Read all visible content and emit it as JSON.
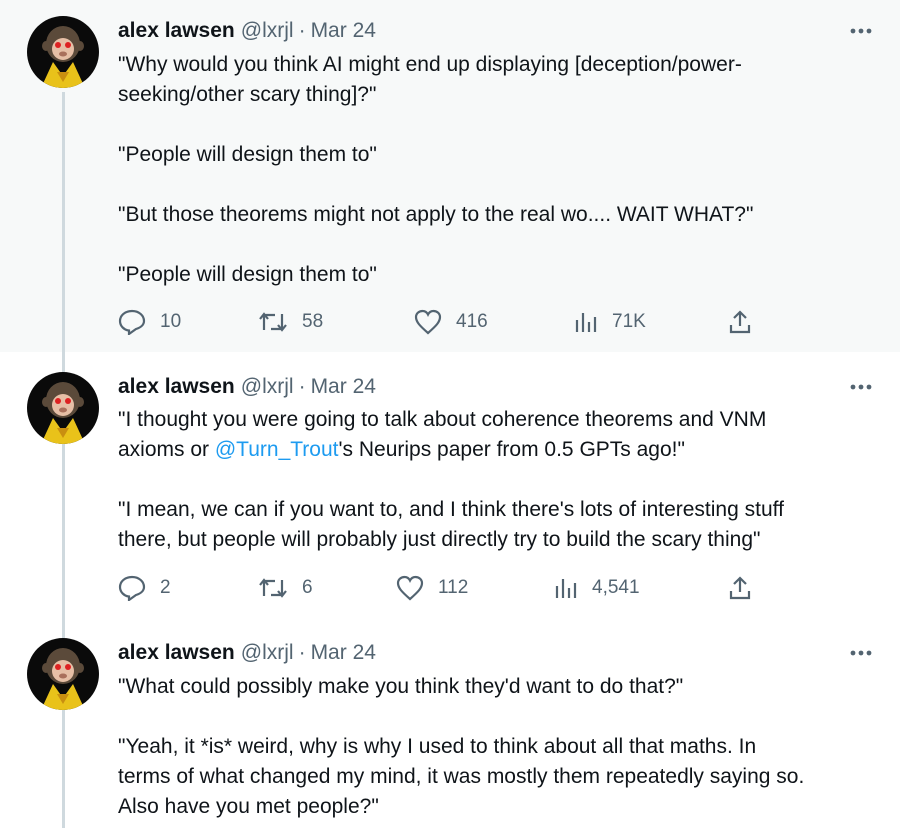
{
  "author": {
    "name": "alex lawsen",
    "handle": "@lxrjl",
    "separator": "·"
  },
  "tweets": [
    {
      "date": "Mar 24",
      "lines": [
        "\"Why would you think AI might end up displaying [deception/power-",
        "seeking/other scary thing]?\"",
        "",
        "\"People will design them to\"",
        "",
        "\"But those theorems might not apply to the real wo.... WAIT WHAT?\"",
        "",
        "\"People will design them to\""
      ],
      "replies": "10",
      "retweets": "58",
      "likes": "416",
      "views": "71K"
    },
    {
      "date": "Mar 24",
      "line1": "\"I thought you were going to talk about coherence theorems and VNM",
      "line2_before": "axioms or ",
      "mention": "@Turn_Trout",
      "line2_after": "'s Neurips paper from 0.5 GPTs ago!\"",
      "line3": "\"I mean, we can if you want to, and I think there's lots of interesting stuff",
      "line4": "there, but people will probably just directly try to build the scary thing\"",
      "replies": "2",
      "retweets": "6",
      "likes": "112",
      "views": "4,541"
    },
    {
      "date": "Mar 24",
      "lines": [
        "\"What could possibly make you think they'd want to do that?\"",
        "",
        "\"Yeah, it *is* weird, why is why I used to think about all that maths. In",
        "terms of what changed my mind, it was mostly them repeatedly saying so.",
        "Also have you met people?\""
      ]
    }
  ],
  "colors": {
    "text": "#0f1419",
    "muted": "#536471",
    "link": "#1d9bf0",
    "line": "#cfd9de",
    "hover_bg": "#f7f9f9"
  },
  "icons": [
    "avatar-monkey",
    "more-icon",
    "reply-icon",
    "retweet-icon",
    "like-icon",
    "views-icon",
    "share-icon"
  ]
}
